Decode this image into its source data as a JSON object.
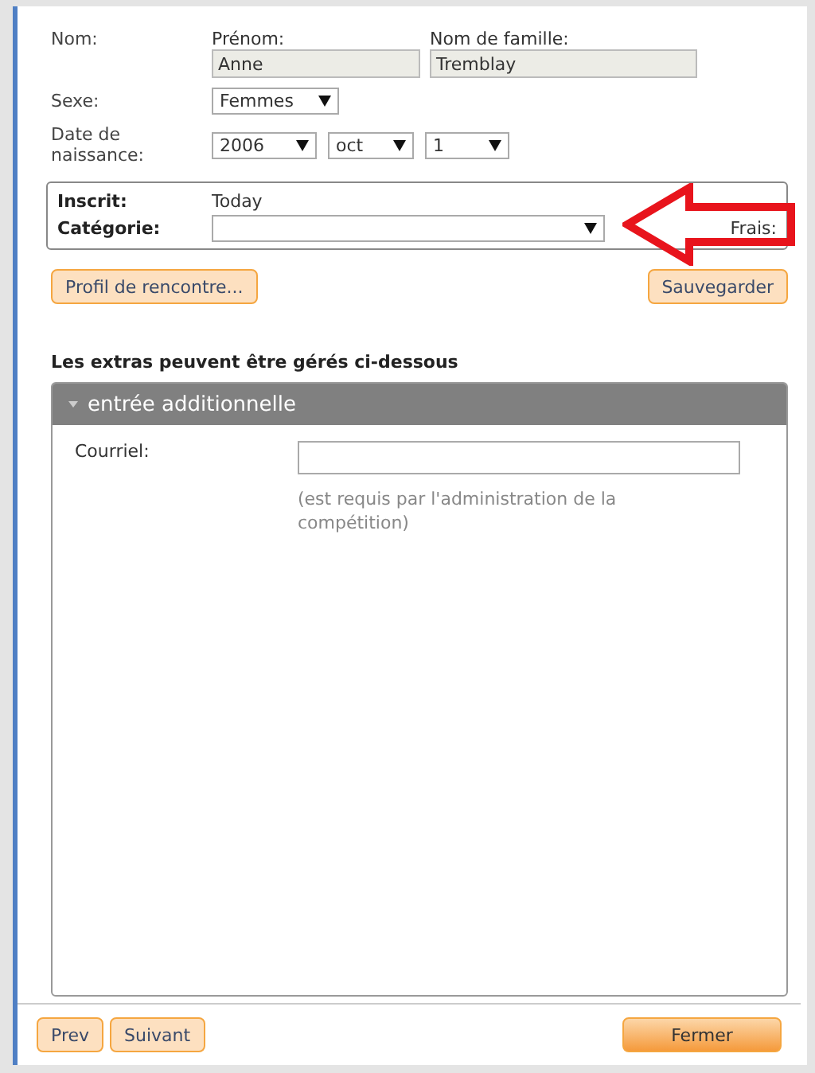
{
  "name": {
    "label": "Nom:",
    "first_name": {
      "label": "Prénom:",
      "value": "Anne"
    },
    "last_name": {
      "label": "Nom de famille:",
      "value": "Tremblay"
    }
  },
  "sex": {
    "label": "Sexe:",
    "value": "Femmes"
  },
  "birth_date": {
    "label": "Date de naissance:",
    "year": "2006",
    "month": "oct",
    "day": "1"
  },
  "registration": {
    "registered_label": "Inscrit:",
    "registered_value": "Today",
    "category_label": "Catégorie:",
    "fee_label": "Frais:"
  },
  "actions": [
    {
      "label": "Profil de rencontre..."
    },
    {
      "label": "Sauvegarder"
    }
  ],
  "extras_heading": "Les extras peuvent être gérés ci-dessous",
  "extras_panel": {
    "title": "entrée additionnelle",
    "expanded": true,
    "fields": [
      {
        "label": "Courriel:",
        "hint": "(est requis par l'administration de la compétition)"
      }
    ]
  },
  "footer_buttons": [
    {
      "label": "Prev",
      "kind": "secondary"
    },
    {
      "label": "Suivant",
      "kind": "secondary"
    },
    {
      "label": "Fermer",
      "kind": "primary"
    }
  ]
}
